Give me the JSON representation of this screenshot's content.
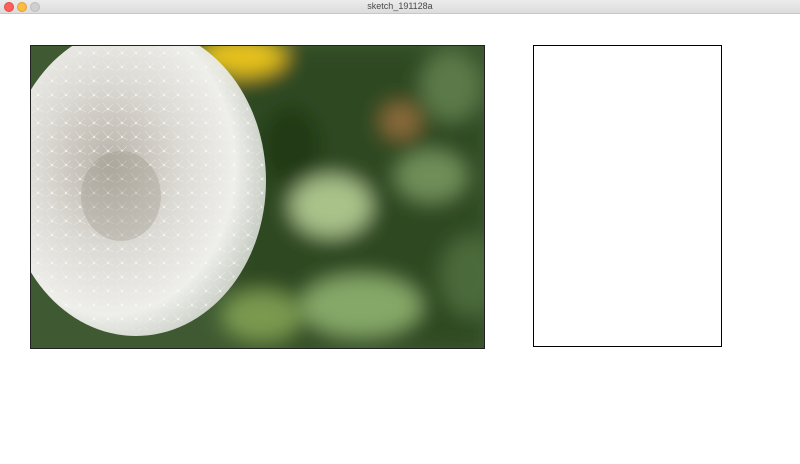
{
  "window": {
    "title": "sketch_191128a"
  },
  "icons": {
    "close": "close-dot",
    "minimize": "minimize-dot",
    "maximize": "maximize-dot"
  },
  "colors": {
    "close": "#fc605c",
    "minimize": "#fdbc40",
    "maximize": "#cfcfcf"
  }
}
